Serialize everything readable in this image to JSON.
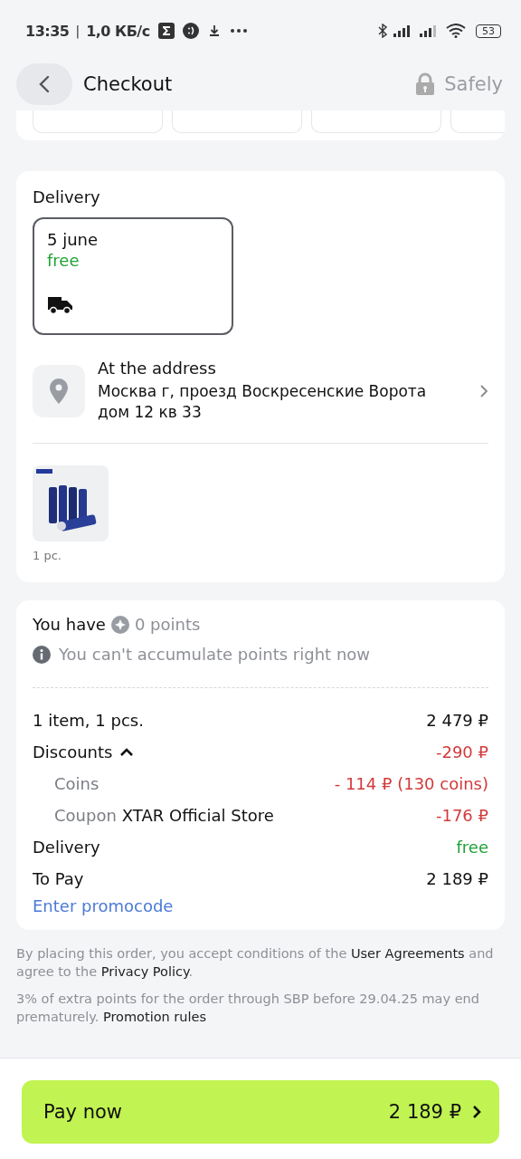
{
  "status_bar": {
    "time": "13:35",
    "separator": "|",
    "speed": "1,0 КБ/с",
    "battery": "53"
  },
  "header": {
    "title": "Checkout",
    "badge": "Safely"
  },
  "delivery": {
    "title": "Delivery",
    "options": [
      {
        "date": "5 june",
        "price": "free",
        "selected": true
      }
    ],
    "address": {
      "label": "At the address",
      "text": "Москва г, проезд Воскресенские Ворота дом 12 кв 33"
    },
    "items": [
      {
        "kind": "picture",
        "quantity": "1 pc."
      }
    ]
  },
  "points": {
    "prefix": "You have",
    "value": "0 points",
    "notice": "You can't accumulate points right now"
  },
  "summary": [
    {
      "label": "1 item, 1 pcs.",
      "value": "2 479 ₽",
      "kind": "main",
      "color": "#111111"
    },
    {
      "label": "Discounts",
      "value": "-290 ₽",
      "kind": "main",
      "color": "#d23a3a",
      "expanded": true
    },
    {
      "label": "Coins",
      "value": "- 114 ₽ (130 coins)",
      "kind": "sub",
      "color": "#d23a3a"
    },
    {
      "label": "Coupon",
      "detail": "XTAR Official Store",
      "value": "-176 ₽",
      "kind": "sub",
      "color": "#d23a3a"
    },
    {
      "label": "Delivery",
      "value": "free",
      "kind": "main",
      "color": "#22a33a"
    },
    {
      "label": "To Pay",
      "value": "2 189 ₽",
      "kind": "main",
      "color": "#111111"
    }
  ],
  "promo_link": "Enter promocode",
  "legal": [
    [
      {
        "text": "By placing this order, you accept conditions of the ",
        "kind": "plain"
      },
      {
        "text": "User Agreements",
        "kind": "link"
      },
      {
        "text": " and agree to the ",
        "kind": "plain"
      },
      {
        "text": "Privacy Policy",
        "kind": "link"
      },
      {
        "text": ".",
        "kind": "plain"
      }
    ],
    [
      {
        "text": "3% of extra points for the order through SBP before 29.04.25 may end prematurely. ",
        "kind": "plain"
      },
      {
        "text": "Promotion rules",
        "kind": "link"
      }
    ]
  ],
  "pay_button": {
    "label": "Pay now",
    "amount": "2 189 ₽"
  }
}
